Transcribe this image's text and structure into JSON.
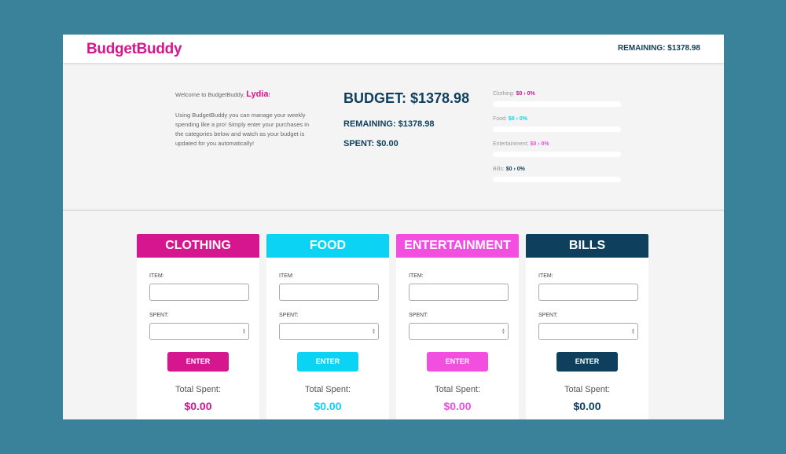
{
  "header": {
    "logo": "BudgetBuddy",
    "remaining": "REMAINING: $1378.98"
  },
  "welcome": {
    "greeting": "Welcome to BudgetBuddy, ",
    "name": "Lydia",
    "punct": "!",
    "description": "Using BudgetBuddy you can manage your weekly spending like a pro! Simply enter your purchases in the categories below and watch as your budget is updated for you automatically!"
  },
  "summary": {
    "budget": "BUDGET: $1378.98",
    "remaining": "REMAINING: $1378.98",
    "spent": "SPENT: $0.00"
  },
  "progress": [
    {
      "label": "Clothing:",
      "value": "$0 › 0%",
      "percent": 0,
      "color": "#d6168e"
    },
    {
      "label": "Food:",
      "value": "$0 › 0%",
      "percent": 0,
      "color": "#0bd3f3"
    },
    {
      "label": "Entertainment:",
      "value": "$0 › 0%",
      "percent": 0,
      "color": "#f24fe0"
    },
    {
      "label": "Bills:",
      "value": "$0 › 0%",
      "percent": 0,
      "color": "#0e3f5c"
    }
  ],
  "categories": [
    {
      "title": "CLOTHING",
      "color": "#d6168e",
      "item_label": "ITEM:",
      "spent_label": "SPENT:",
      "item_value": "",
      "spent_value": "",
      "button": "ENTER",
      "total_label": "Total Spent:",
      "total": "$0.00"
    },
    {
      "title": "FOOD",
      "color": "#0bd3f3",
      "item_label": "ITEM:",
      "spent_label": "SPENT:",
      "item_value": "",
      "spent_value": "",
      "button": "ENTER",
      "total_label": "Total Spent:",
      "total": "$0.00"
    },
    {
      "title": "ENTERTAINMENT",
      "color": "#f24fe0",
      "item_label": "ITEM:",
      "spent_label": "SPENT:",
      "item_value": "",
      "spent_value": "",
      "button": "ENTER",
      "total_label": "Total Spent:",
      "total": "$0.00"
    },
    {
      "title": "BILLS",
      "color": "#0e3f5c",
      "item_label": "ITEM:",
      "spent_label": "SPENT:",
      "item_value": "",
      "spent_value": "",
      "button": "ENTER",
      "total_label": "Total Spent:",
      "total": "$0.00"
    }
  ]
}
